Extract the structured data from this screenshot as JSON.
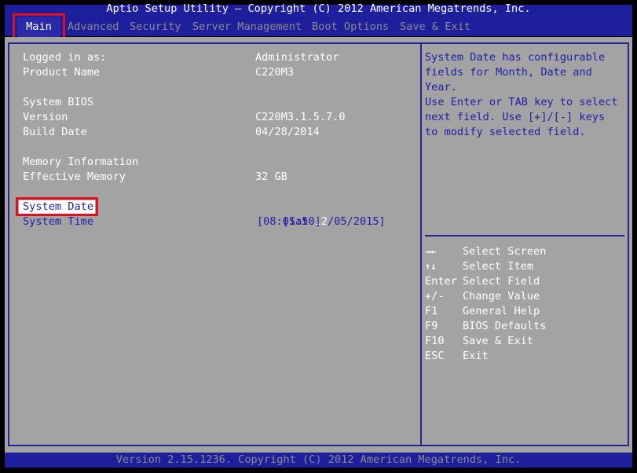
{
  "header": {
    "title": "Aptio Setup Utility – Copyright (C) 2012 American Megatrends, Inc.",
    "tabs": [
      {
        "label": "Main"
      },
      {
        "label": "Advanced"
      },
      {
        "label": "Security"
      },
      {
        "label": "Server Management"
      },
      {
        "label": "Boot Options"
      },
      {
        "label": "Save & Exit"
      }
    ]
  },
  "main": {
    "logged_in": {
      "label": "Logged in as:",
      "value": "Administrator"
    },
    "product_name": {
      "label": "Product Name",
      "value": "C220M3"
    },
    "system_bios_heading": "System BIOS",
    "version": {
      "label": "Version",
      "value": "C220M3.1.5.7.0"
    },
    "build_date": {
      "label": "Build Date",
      "value": "04/28/2014"
    },
    "memory_heading": "Memory Information",
    "effective_memory": {
      "label": "Effective Memory",
      "value": "32 GB"
    },
    "system_date": {
      "label": "System Date",
      "value_prefix": "[Sat ",
      "value_selected": "12",
      "value_suffix": "/05/2015]"
    },
    "system_time": {
      "label": "System Time",
      "value": "[08:01:50]"
    }
  },
  "help": {
    "lines": [
      "System Date has configurable",
      "fields for Month, Date and",
      "Year.",
      "Use Enter or TAB key to select",
      "next field. Use [+]/[-] keys",
      "to modify selected field."
    ]
  },
  "keys": [
    {
      "key": "→←",
      "desc": "Select Screen"
    },
    {
      "key": "↑↓",
      "desc": "Select Item"
    },
    {
      "key": "Enter",
      "desc": "Select Field"
    },
    {
      "key": "+/-",
      "desc": "Change Value"
    },
    {
      "key": "F1",
      "desc": "General Help"
    },
    {
      "key": "F9",
      "desc": "BIOS Defaults"
    },
    {
      "key": "F10",
      "desc": "Save & Exit"
    },
    {
      "key": "ESC",
      "desc": "Exit"
    }
  ],
  "footer": {
    "text": "Version 2.15.1236. Copyright (C) 2012 American Megatrends, Inc."
  },
  "colors": {
    "header_blue": "#1d1f9c",
    "body_grey": "#a3a3a3",
    "highlight_red": "#e0101e"
  }
}
